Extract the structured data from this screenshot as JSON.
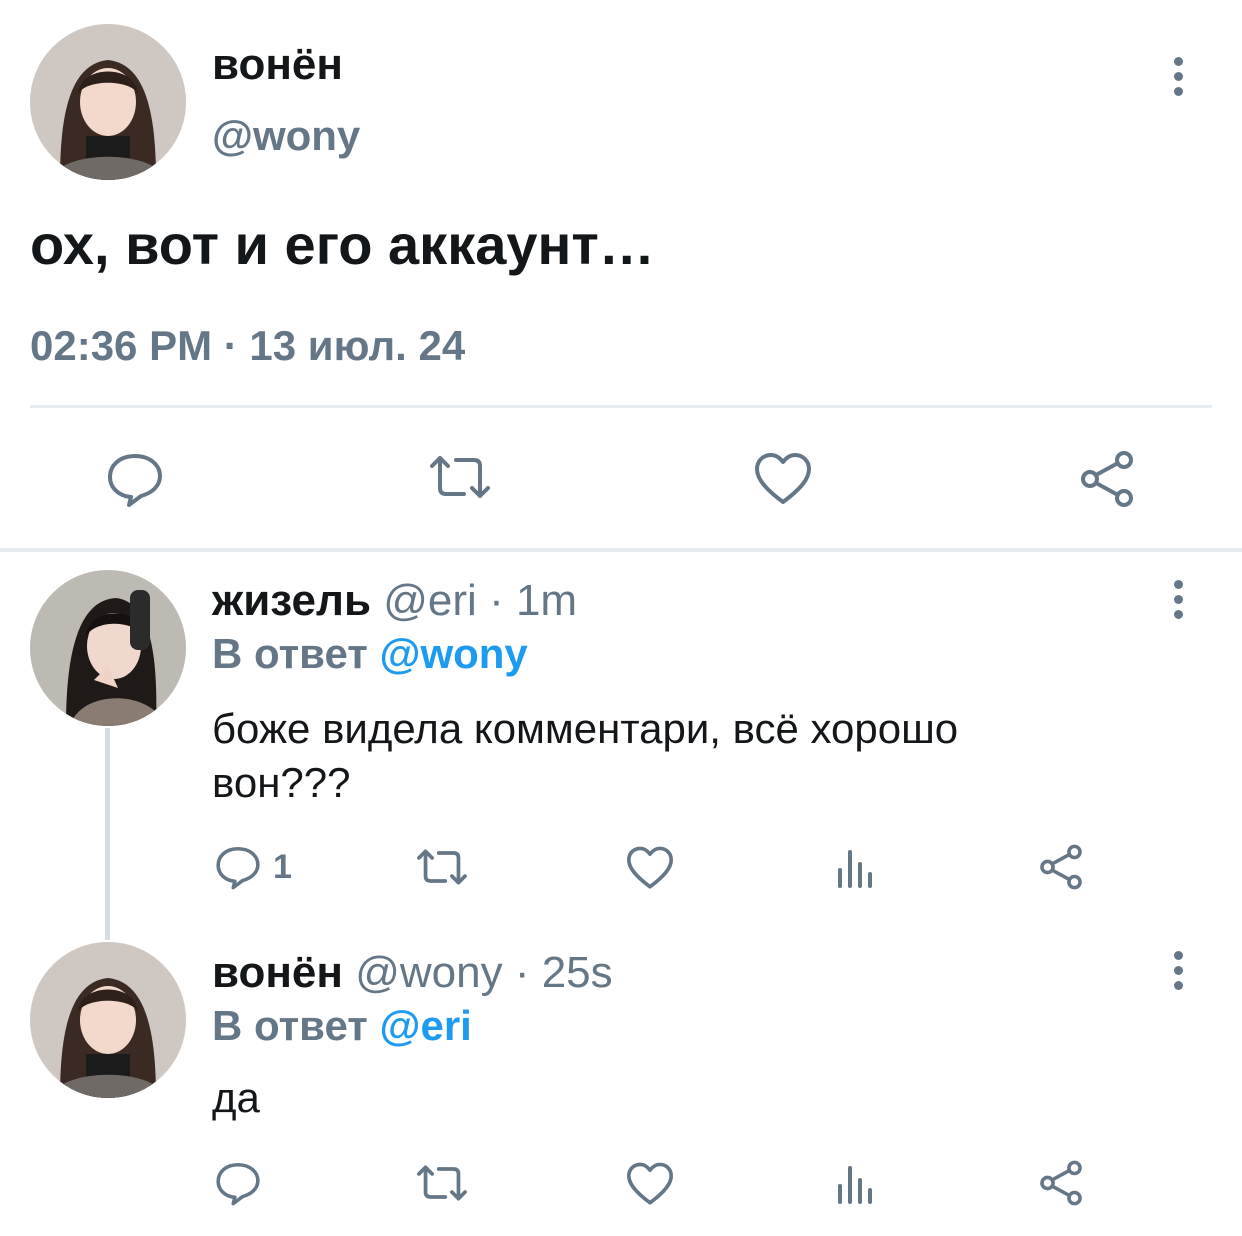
{
  "main_tweet": {
    "display_name": "вонён",
    "handle": "@wony",
    "text": "ох, вот и его аккаунт…",
    "timestamp": "02:36 PM · 13 июл. 24"
  },
  "replies": [
    {
      "display_name": "жизель",
      "handle": "@eri",
      "time": "· 1m",
      "reply_prefix": "В ответ",
      "reply_to": "@wony",
      "text_line1": "боже видела комментари, всё хорошо",
      "text_line2": "вон???",
      "reply_count": "1"
    },
    {
      "display_name": "вонён",
      "handle": "@wony",
      "time": "· 25s",
      "reply_prefix": "В ответ",
      "reply_to": "@eri",
      "text_line1": "да"
    }
  ],
  "icons": {
    "reply": "speech-bubble-icon",
    "retweet": "retweet-icon",
    "like": "heart-icon",
    "views": "bar-chart-icon",
    "share": "share-icon",
    "more": "more-vertical-icon"
  },
  "colors": {
    "text": "#14171a",
    "secondary": "#657786",
    "accent": "#1d9bf0",
    "divider": "#e6ecf0"
  }
}
